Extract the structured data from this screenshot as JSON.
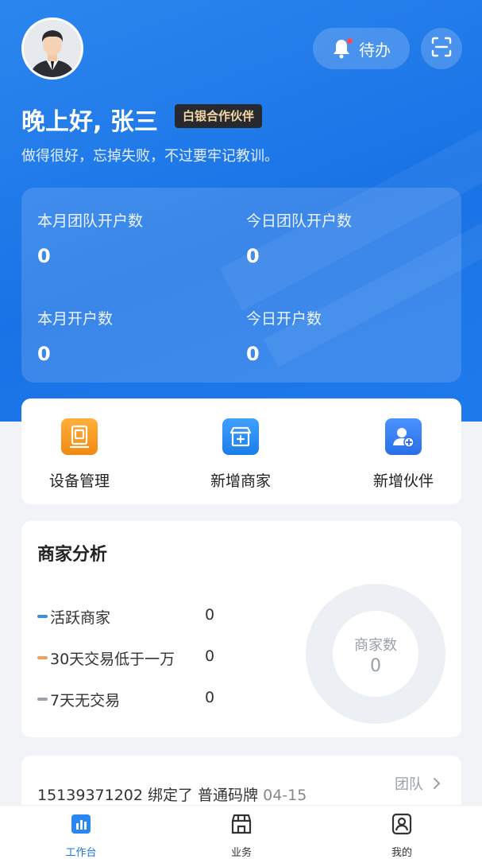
{
  "header": {
    "todo_label": "待办",
    "greeting": "晚上好, 张三",
    "badge": "白银合作伙伴",
    "motto": "做得很好，忘掉失败，不过要牢记教训。"
  },
  "stats": [
    {
      "label": "本月团队开户数",
      "value": "0"
    },
    {
      "label": "今日团队开户数",
      "value": "0"
    },
    {
      "label": "本月开户数",
      "value": "0"
    },
    {
      "label": "今日开户数",
      "value": "0"
    }
  ],
  "actions": [
    {
      "label": "设备管理",
      "icon": "device-icon",
      "color": "#f59a23"
    },
    {
      "label": "新增商家",
      "icon": "store-add-icon",
      "color": "#2a8af0"
    },
    {
      "label": "新增伙伴",
      "icon": "user-add-icon",
      "color": "#2a7ff0"
    }
  ],
  "merchant_analysis": {
    "title": "商家分析",
    "legend": [
      {
        "name": "活跃商家",
        "value": "0",
        "color": "#3a8ee6"
      },
      {
        "name": "30天交易低于一万",
        "value": "0",
        "color": "#f0a25a"
      },
      {
        "name": "7天无交易",
        "value": "0",
        "color": "#9ea3ab"
      }
    ],
    "donut_label": "商家数",
    "donut_value": "0"
  },
  "activity": {
    "message": "15139371202 绑定了 普通码牌",
    "date": "04-15",
    "link_label": "团队"
  },
  "tabbar": [
    {
      "label": "工作台",
      "icon": "dashboard-icon",
      "active": true
    },
    {
      "label": "业务",
      "icon": "business-icon",
      "active": false
    },
    {
      "label": "我的",
      "icon": "profile-icon",
      "active": false
    }
  ],
  "colors": {
    "primary": "#1a73e6",
    "badge_bg": "#27292f",
    "badge_text": "#f5d8a5"
  }
}
